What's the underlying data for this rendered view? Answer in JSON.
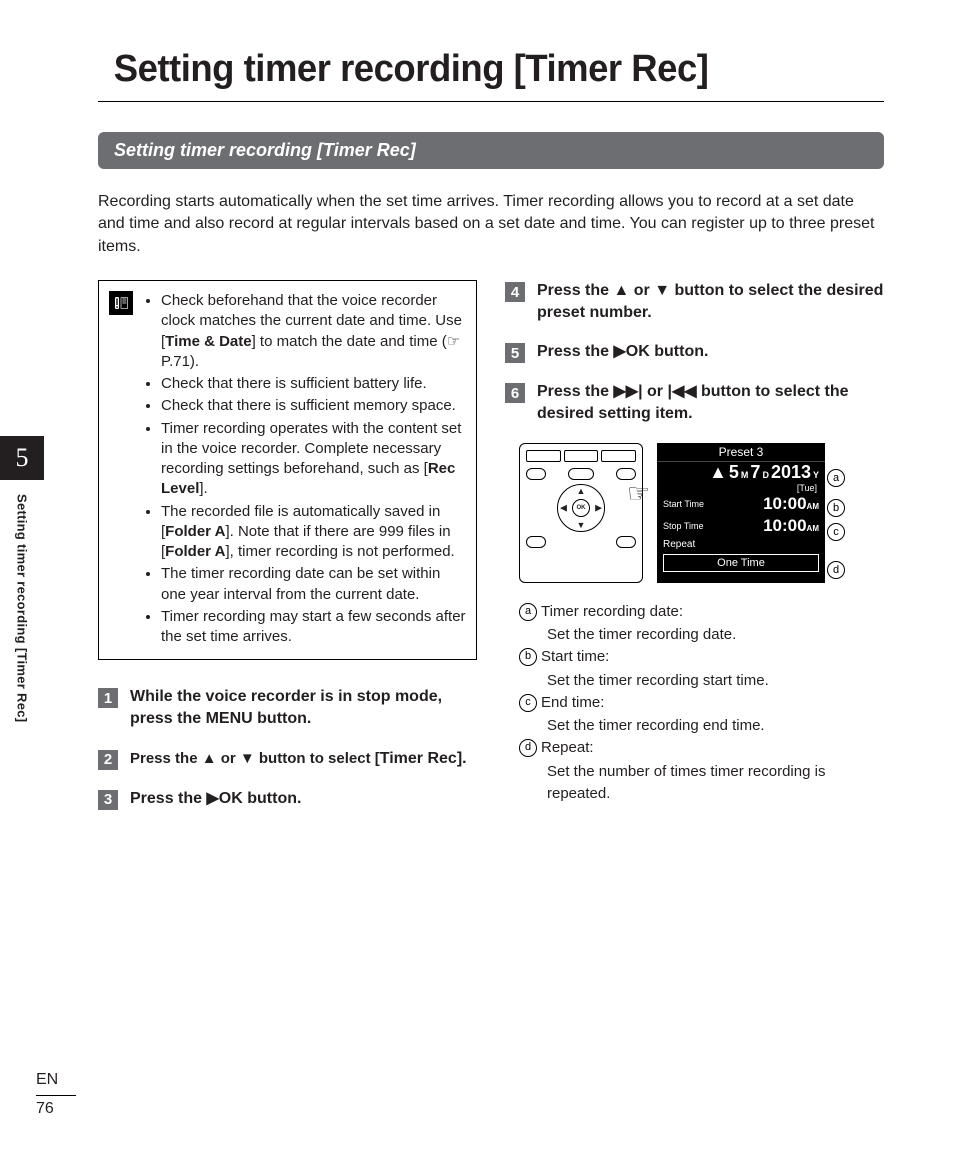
{
  "page_title": "Setting timer recording [Timer Rec]",
  "section_bar": "Setting timer recording [Timer Rec]",
  "intro": "Recording starts automatically when the set time arrives. Timer recording allows you to record at a set date and time and also record at regular intervals based on a set date and time. You can register up to three preset items.",
  "notes": {
    "n1_a": "Check beforehand that the voice recorder clock matches the current date and time. Use [",
    "n1_bold": "Time & Date",
    "n1_b": "] to match the date and time (☞ P.71).",
    "n2": "Check that there is sufficient battery life.",
    "n3": "Check that there is sufficient memory space.",
    "n4_a": "Timer recording operates with the content set in the voice recorder. Complete necessary recording settings beforehand, such as [",
    "n4_bold": "Rec Level",
    "n4_b": "].",
    "n5_a": "The recorded file is automatically saved in [",
    "n5_bold1": "Folder A",
    "n5_b": "]. Note that if there are 999 files in [",
    "n5_bold2": "Folder A",
    "n5_c": "], timer recording is not performed.",
    "n6": "The timer recording date can be set within one year interval from the current date.",
    "n7": "Timer recording may start a few seconds after the set time arrives."
  },
  "steps": {
    "s1_a": "While the voice recorder is in stop mode, press the ",
    "s1_bold": "MENU",
    "s1_b": " button.",
    "s2_a": "Press the ▲ or ▼ button to select [",
    "s2_bold": "Timer Rec",
    "s2_b": "].",
    "s3_a": "Press the ",
    "s3_ok": "▶OK",
    "s3_b": " button.",
    "s4": "Press the ▲ or ▼ button to select the desired preset number.",
    "s5_a": "Press the ",
    "s5_ok": "▶OK",
    "s5_b": " button.",
    "s6": "Press the ▶▶| or |◀◀ button to select the desired setting item."
  },
  "screen": {
    "title": "Preset 3",
    "month": "5",
    "month_l": "M",
    "day": "7",
    "day_l": "D",
    "year": "2013",
    "year_l": "Y",
    "weekday": "[Tue]",
    "start_label": "Start Time",
    "start_time": "10:00",
    "start_am": "AM",
    "stop_label": "Stop Time",
    "stop_time": "10:00",
    "stop_am": "AM",
    "repeat_label": "Repeat",
    "repeat_value": "One Time"
  },
  "callouts": {
    "a": "a",
    "b": "b",
    "c": "c",
    "d": "d"
  },
  "legend": {
    "a_t": "Timer recording date:",
    "a_d": "Set the timer recording date.",
    "b_t": "Start time:",
    "b_d": "Set the timer recording start time.",
    "c_t": "End time:",
    "c_d": "Set the timer recording end time.",
    "d_t": "Repeat:",
    "d_d": "Set the number of times timer recording is repeated."
  },
  "side": {
    "num": "5",
    "label": "Setting timer recording [Timer Rec]"
  },
  "footer": {
    "lang": "EN",
    "page": "76"
  }
}
